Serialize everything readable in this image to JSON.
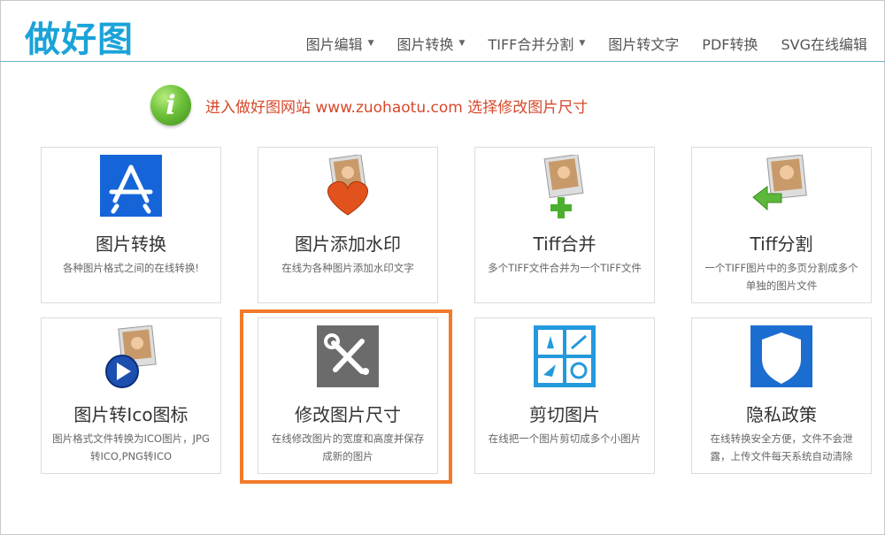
{
  "header": {
    "logo": "做好图",
    "nav": [
      {
        "label": "图片编辑",
        "dropdown": true
      },
      {
        "label": "图片转换",
        "dropdown": true
      },
      {
        "label": "TIFF合并分割",
        "dropdown": true
      },
      {
        "label": "图片转文字",
        "dropdown": false
      },
      {
        "label": "PDF转换",
        "dropdown": false
      },
      {
        "label": "SVG在线编辑",
        "dropdown": false
      }
    ]
  },
  "notice": {
    "icon": "info-icon",
    "text": "进入做好图网站  www.zuohaotu.com  选择修改图片尺寸"
  },
  "cards": [
    {
      "title": "图片转换",
      "desc": "各种图片格式之间的在线转换!",
      "icon": "app-store-icon"
    },
    {
      "title": "图片添加水印",
      "desc": "在线为各种图片添加水印文字",
      "icon": "photo-heart-icon"
    },
    {
      "title": "Tiff合并",
      "desc": "多个TIFF文件合并为一个TIFF文件",
      "icon": "photo-plus-icon"
    },
    {
      "title": "Tiff分割",
      "desc": "一个TIFF图片中的多页分割成多个单独的图片文件",
      "icon": "photo-split-icon"
    },
    {
      "title": "图片转Ico图标",
      "desc": "图片格式文件转换为ICO图片，JPG转ICO,PNG转ICO",
      "icon": "photo-play-icon"
    },
    {
      "title": "修改图片尺寸",
      "desc": "在线修改图片的宽度和高度并保存成新的图片",
      "icon": "tools-icon"
    },
    {
      "title": "剪切图片",
      "desc": "在线把一个图片剪切成多个小图片",
      "icon": "crop-grid-icon"
    },
    {
      "title": "隐私政策",
      "desc": "在线转换安全方便，文件不会泄露，上传文件每天系统自动清除",
      "icon": "shield-icon"
    }
  ],
  "highlighted_card": "修改图片尺寸",
  "colors": {
    "brand": "#1aa3d8",
    "notice": "#d7482a",
    "highlight": "#f27a2a"
  }
}
